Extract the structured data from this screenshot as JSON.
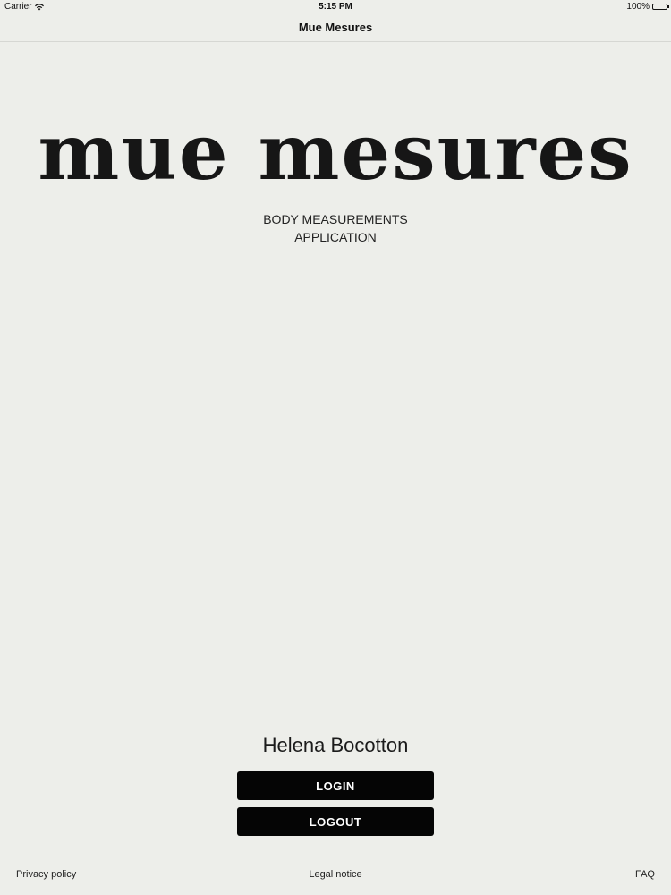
{
  "status_bar": {
    "carrier": "Carrier",
    "time": "5:15 PM",
    "battery": "100%"
  },
  "nav": {
    "title": "Mue Mesures"
  },
  "brand": {
    "logo_text": "mue mesures",
    "tagline_line1": "BODY MEASUREMENTS",
    "tagline_line2": "APPLICATION"
  },
  "user": {
    "name": "Helena Bocotton"
  },
  "actions": {
    "login_label": "LOGIN",
    "logout_label": "LOGOUT"
  },
  "footer": {
    "privacy": "Privacy policy",
    "legal": "Legal notice",
    "faq": "FAQ"
  },
  "colors": {
    "background": "#edeeea",
    "button": "#050505",
    "button_text": "#ffffff"
  }
}
